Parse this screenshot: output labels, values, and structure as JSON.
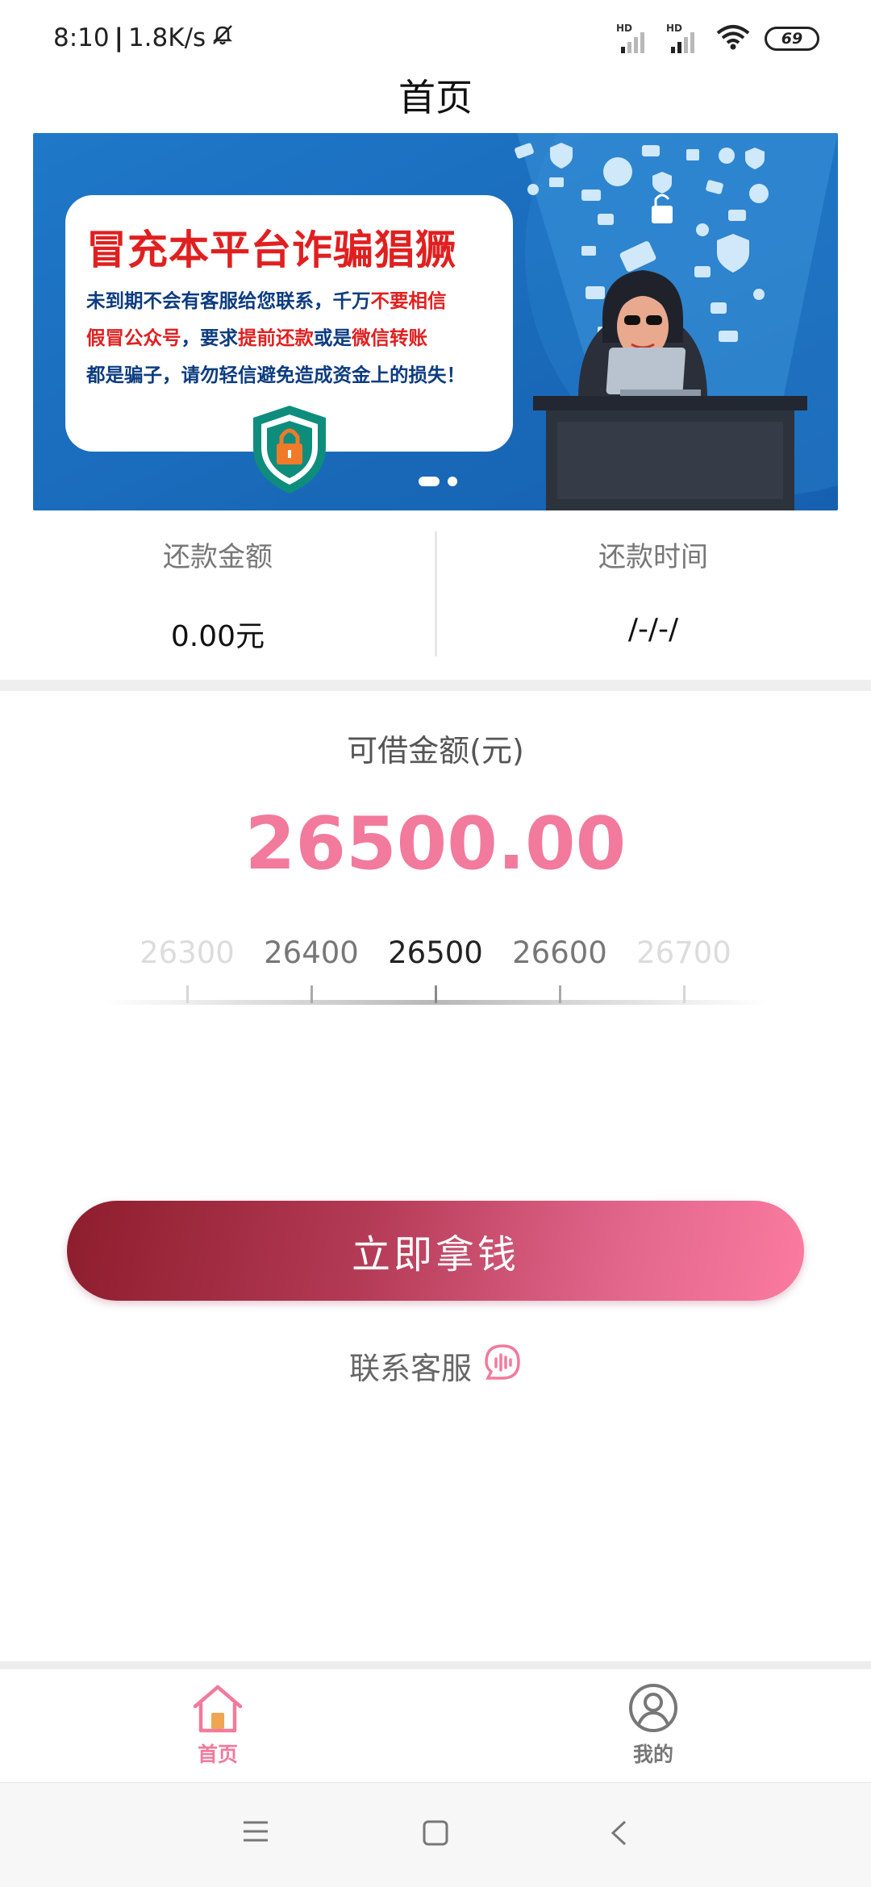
{
  "status_bar": {
    "time": "8:10",
    "speed": "1.8K/s",
    "sim1_label": "HD",
    "sim2_label": "HD",
    "battery": "69"
  },
  "header": {
    "title": "首页"
  },
  "banner": {
    "headline": "冒充本平台诈骗猖獗",
    "line1_parts": [
      "未到期不会有客服给您联系，千万",
      "不要相信"
    ],
    "line2_parts": [
      "假冒公众号",
      "，要求",
      "提前还款",
      "或是",
      "微信转账"
    ],
    "line3": "都是骗子，请勿轻信避免造成资金上的损失！",
    "slides_count": 2,
    "active_slide": 1
  },
  "repayment": {
    "amount_label": "还款金额",
    "amount_value": "0.00元",
    "time_label": "还款时间",
    "time_value": "/-/-/"
  },
  "loan": {
    "label": "可借金额(元)",
    "amount": "26500.00",
    "ruler": [
      "26300",
      "26400",
      "26500",
      "26600",
      "26700"
    ],
    "selected_index": 2
  },
  "cta": {
    "label": "立即拿钱"
  },
  "contact": {
    "label": "联系客服"
  },
  "bottom_nav": {
    "items": [
      {
        "label": "首页",
        "icon": "home-icon",
        "active": true
      },
      {
        "label": "我的",
        "icon": "profile-icon",
        "active": false
      }
    ]
  },
  "colors": {
    "accent_pink": "#f27a9c",
    "banner_blue": "#1a6cc0",
    "warning_red": "#e02020"
  }
}
